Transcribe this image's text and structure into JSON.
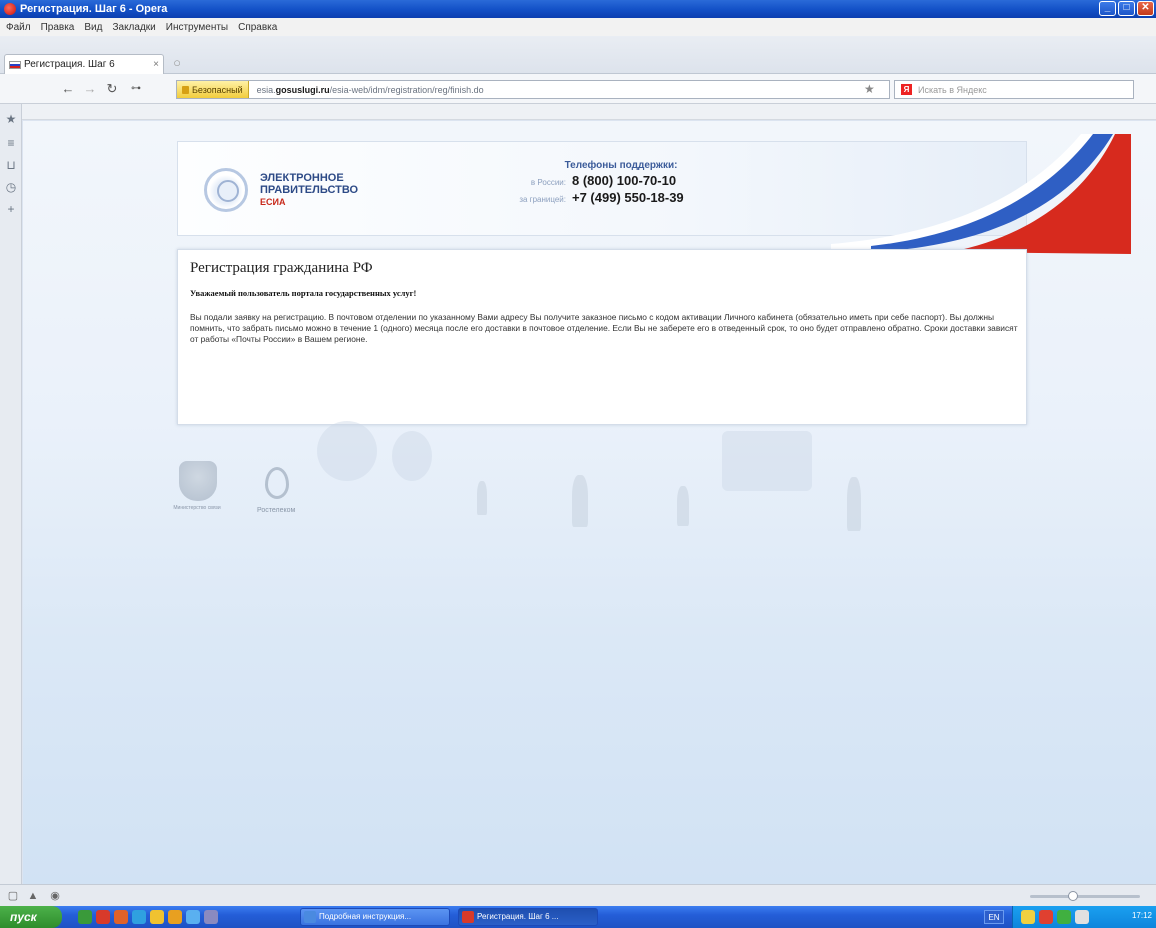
{
  "window": {
    "title": "Регистрация. Шаг 6 - Opera",
    "buttons": [
      "_",
      "□",
      "✕"
    ]
  },
  "menu": [
    "Файл",
    "Правка",
    "Вид",
    "Закладки",
    "Инструменты",
    "Справка"
  ],
  "tab": {
    "label": "Регистрация. Шаг 6",
    "close": "×"
  },
  "nav": {
    "secure_label": "Безопасный",
    "url_prefix": "esia.",
    "url_domain": "gosuslugi.ru",
    "url_path": "/esia-web/idm/registration/reg/finish.do",
    "search_placeholder": "Искать в Яндекс"
  },
  "header": {
    "logo_line1": "ЭЛЕКТРОННОЕ",
    "logo_line2": "ПРАВИТЕЛЬСТВО",
    "logo_line3": "ЕСИА",
    "support_title": "Телефоны поддержки:",
    "phone1_label": "в России:",
    "phone1": "8 (800) 100-70-10",
    "phone2_label": "за границей:",
    "phone2": "+7 (499) 550-18-39"
  },
  "content": {
    "title": "Регистрация гражданина РФ",
    "greeting": "Уважаемый пользователь портала государственных услуг!",
    "body": "Вы подали заявку на регистрацию. В почтовом отделении по указанному Вами адресу Вы получите заказное письмо с кодом активации Личного кабинета (обязательно иметь при себе паспорт). Вы должны помнить, что забрать письмо можно в течение 1 (одного) месяца после его доставки в почтовое отделение. Если Вы не заберете его в отведенный срок, то оно будет отправлено обратно. Сроки доставки зависят от работы «Почты России» в Вашем регионе."
  },
  "footer": {
    "emblem_label": "Министерство связи",
    "rostel_label": "Ростелеком"
  },
  "taskbar": {
    "start": "пуск",
    "task1": "Подробная инструкция...",
    "task2": "Регистрация. Шаг 6 ...",
    "lang": "EN",
    "clock": "17:12"
  },
  "colors": {
    "titlebar": "#1452c8",
    "accent_blue": "#2d4a86",
    "esia_red": "#c8291b",
    "taskbar": "#245ed8",
    "start_green": "#2e8d2c"
  }
}
